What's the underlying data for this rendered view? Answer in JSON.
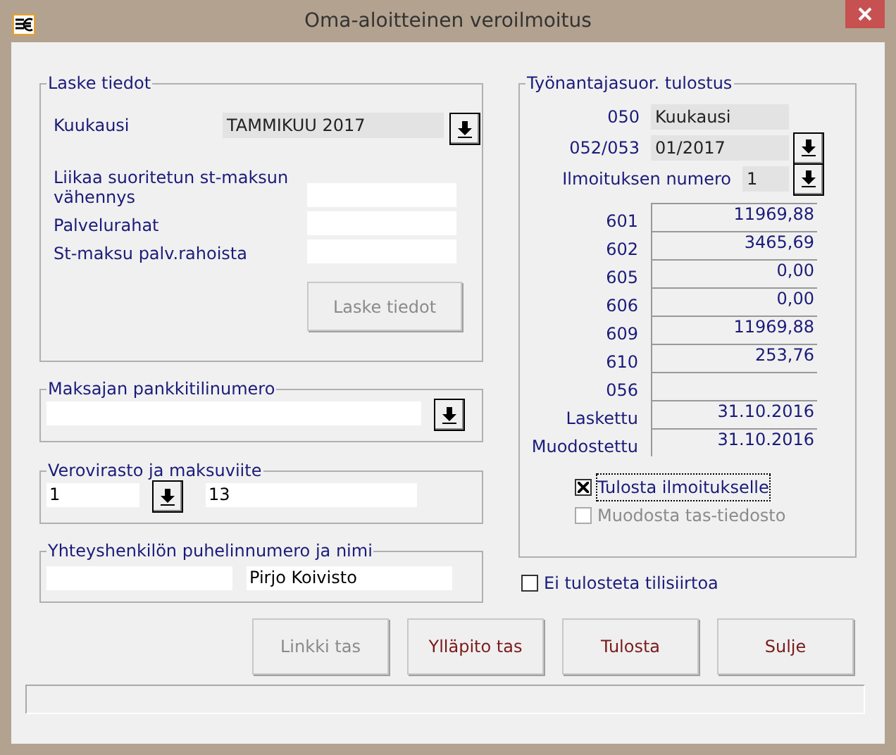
{
  "window": {
    "title": "Oma-aloitteinen veroilmoitus"
  },
  "laske_tiedot": {
    "legend": "Laske tiedot",
    "kuukausi": {
      "label": "Kuukausi",
      "value": "TAMMIKUU 2017"
    },
    "fields": [
      {
        "label": "Liikaa suoritetun st-maksun vähennys"
      },
      {
        "label": "Palvelurahat"
      },
      {
        "label": "St-maksu palv.rahoista"
      }
    ],
    "button": {
      "label": "Laske tiedot",
      "disabled": true
    }
  },
  "maksajan_pankkitili": {
    "legend": "Maksajan pankkitilinumero"
  },
  "verovirasto": {
    "legend": "Verovirasto ja maksuviite",
    "values": [
      "1",
      "13"
    ]
  },
  "yhteyshenkilo": {
    "legend": "Yhteyshenkilön puhelinnumero ja nimi",
    "name": "Pirjo Koivisto"
  },
  "tulostus": {
    "legend": "Työnantajasuor. tulostus",
    "rows": [
      {
        "code": "050",
        "kind": "static",
        "value": "Kuukausi"
      },
      {
        "code": "052/053",
        "kind": "dropdown",
        "value": "01/2017"
      },
      {
        "code": "Ilmoituksen numero",
        "kind": "dropdown",
        "value": "1"
      }
    ],
    "amounts": [
      {
        "code": "601",
        "value": "11969,88"
      },
      {
        "code": "602",
        "value": "3465,69"
      },
      {
        "code": "605",
        "value": "0,00"
      },
      {
        "code": "606",
        "value": "0,00"
      },
      {
        "code": "609",
        "value": "11969,88"
      },
      {
        "code": "610",
        "value": "253,76"
      },
      {
        "code": "056"
      },
      {
        "code": "Laskettu",
        "value": "31.10.2016"
      },
      {
        "code": "Muodostettu",
        "value": "31.10.2016"
      }
    ],
    "checkboxes": [
      {
        "label": "Tulosta ilmoitukselle",
        "checked": true,
        "disabled": false,
        "focused": true
      },
      {
        "label": "Muodosta tas-tiedosto",
        "checked": false,
        "disabled": true,
        "focused": false
      }
    ]
  },
  "ei_tulosteta": {
    "label": "Ei tulosteta tilisiirtoa",
    "checked": false
  },
  "buttons": [
    {
      "label": "Linkki tas",
      "disabled": true
    },
    {
      "label": "Ylläpito tas",
      "disabled": false
    },
    {
      "label": "Tulosta",
      "disabled": false
    },
    {
      "label": "Sulje",
      "disabled": false
    }
  ]
}
